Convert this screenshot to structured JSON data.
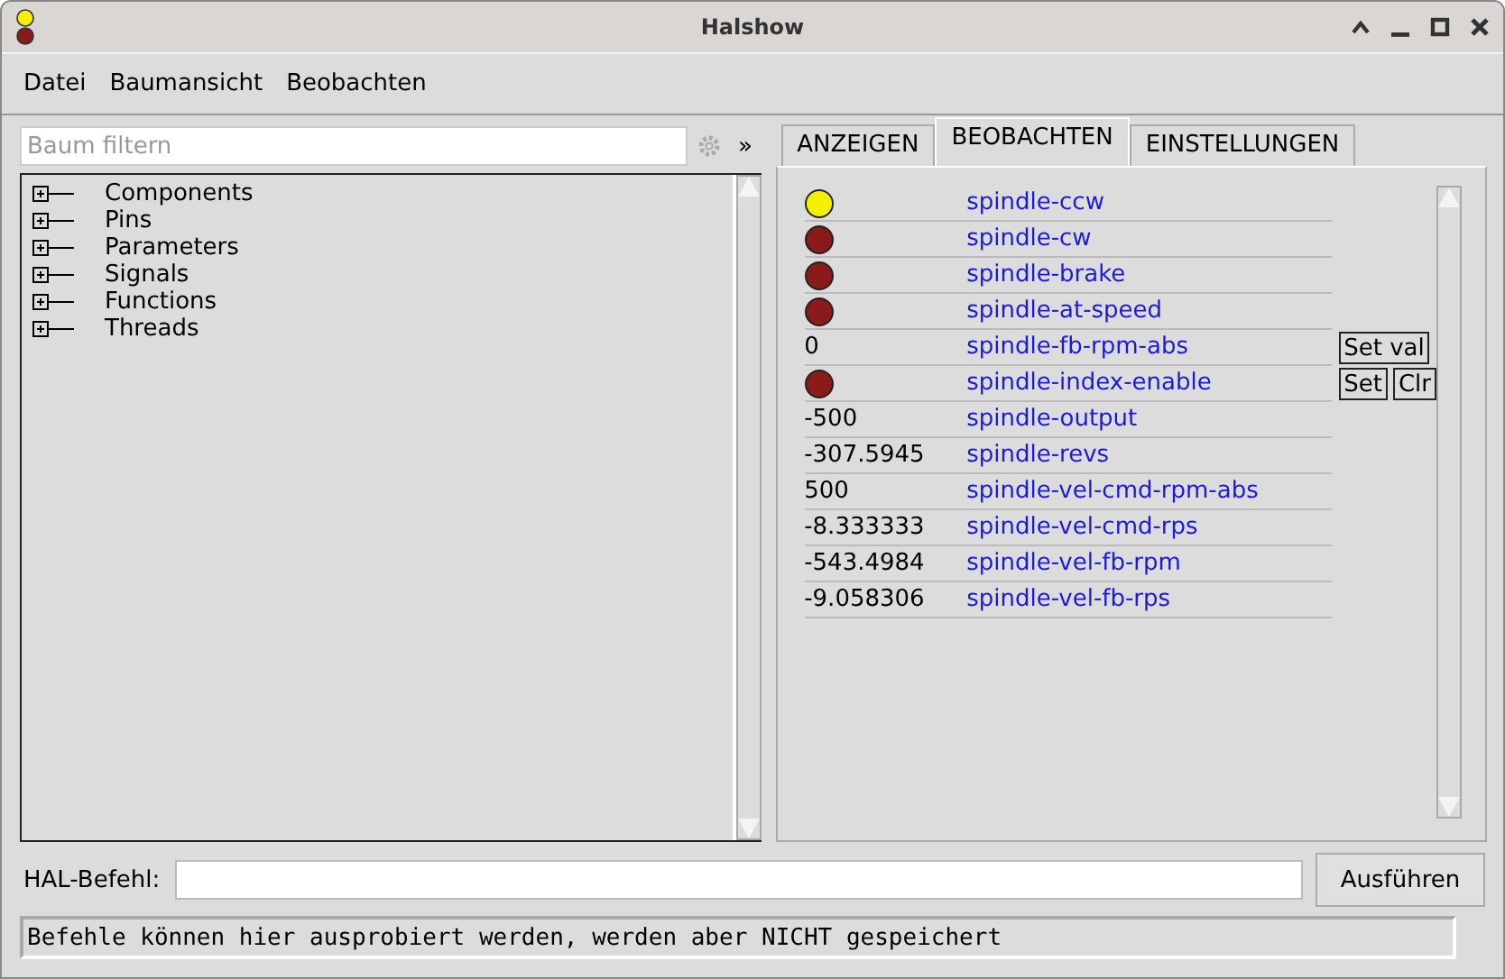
{
  "window": {
    "title": "Halshow"
  },
  "menu": [
    "Datei",
    "Baumansicht",
    "Beobachten"
  ],
  "filter": {
    "placeholder": "Baum filtern",
    "expand_label": "»"
  },
  "tree": [
    {
      "label": "Components",
      "expanded": false
    },
    {
      "label": "Pins",
      "expanded": false
    },
    {
      "label": "Parameters",
      "expanded": false
    },
    {
      "label": "Signals",
      "expanded": false
    },
    {
      "label": "Functions",
      "expanded": false
    },
    {
      "label": "Threads",
      "expanded": false
    }
  ],
  "tabs": [
    {
      "label": "ANZEIGEN",
      "selected": false
    },
    {
      "label": "BEOBACHTEN",
      "selected": true
    },
    {
      "label": "EINSTELLUNGEN",
      "selected": false
    }
  ],
  "watch": [
    {
      "kind": "bit",
      "on": true,
      "name": "spindle-ccw"
    },
    {
      "kind": "bit",
      "on": false,
      "name": "spindle-cw"
    },
    {
      "kind": "bit",
      "on": false,
      "name": "spindle-brake"
    },
    {
      "kind": "bit",
      "on": false,
      "name": "spindle-at-speed"
    },
    {
      "kind": "value",
      "value": "0",
      "name": "spindle-fb-rpm-abs",
      "buttons": [
        "Set val"
      ]
    },
    {
      "kind": "bit",
      "on": false,
      "name": "spindle-index-enable",
      "buttons": [
        "Set",
        "Clr"
      ]
    },
    {
      "kind": "value",
      "value": "-500",
      "name": "spindle-output"
    },
    {
      "kind": "value",
      "value": "-307.5945",
      "name": "spindle-revs"
    },
    {
      "kind": "value",
      "value": "500",
      "name": "spindle-vel-cmd-rpm-abs"
    },
    {
      "kind": "value",
      "value": "-8.333333",
      "name": "spindle-vel-cmd-rps"
    },
    {
      "kind": "value",
      "value": "-543.4984",
      "name": "spindle-vel-fb-rpm"
    },
    {
      "kind": "value",
      "value": "-9.058306",
      "name": "spindle-vel-fb-rps"
    }
  ],
  "command": {
    "label": "HAL-Befehl:",
    "button": "Ausführen"
  },
  "status_bar": "Befehle können hier ausprobiert werden, werden aber NICHT gespeichert"
}
